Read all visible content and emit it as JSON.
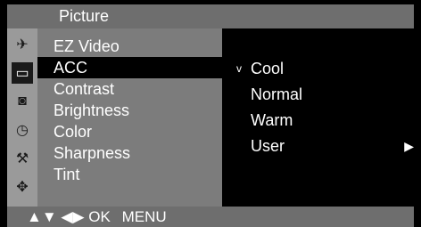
{
  "title": "Picture",
  "icons": [
    {
      "name": "satellite-icon",
      "glyph": "✈",
      "selected": false
    },
    {
      "name": "screen-icon",
      "glyph": "▭",
      "selected": true
    },
    {
      "name": "speaker-icon",
      "glyph": "◙",
      "selected": false
    },
    {
      "name": "clock-icon",
      "glyph": "◷",
      "selected": false
    },
    {
      "name": "key-icon",
      "glyph": "⚒",
      "selected": false
    },
    {
      "name": "settings-icon",
      "glyph": "✥",
      "selected": false
    }
  ],
  "menu": {
    "items": [
      {
        "label": "EZ Video",
        "selected": false
      },
      {
        "label": "ACC",
        "selected": true
      },
      {
        "label": "Contrast",
        "selected": false
      },
      {
        "label": "Brightness",
        "selected": false
      },
      {
        "label": "Color",
        "selected": false
      },
      {
        "label": "Sharpness",
        "selected": false
      },
      {
        "label": "Tint",
        "selected": false
      }
    ]
  },
  "submenu": {
    "check_mark": "v",
    "arrow": "▶",
    "items": [
      {
        "label": "Cool",
        "checked": true,
        "has_arrow": false
      },
      {
        "label": "Normal",
        "checked": false,
        "has_arrow": false
      },
      {
        "label": "Warm",
        "checked": false,
        "has_arrow": false
      },
      {
        "label": "User",
        "checked": false,
        "has_arrow": true
      }
    ]
  },
  "footer": {
    "nav_icons": "▲▼ ◀▶",
    "ok": "OK",
    "menu": "MENU"
  }
}
